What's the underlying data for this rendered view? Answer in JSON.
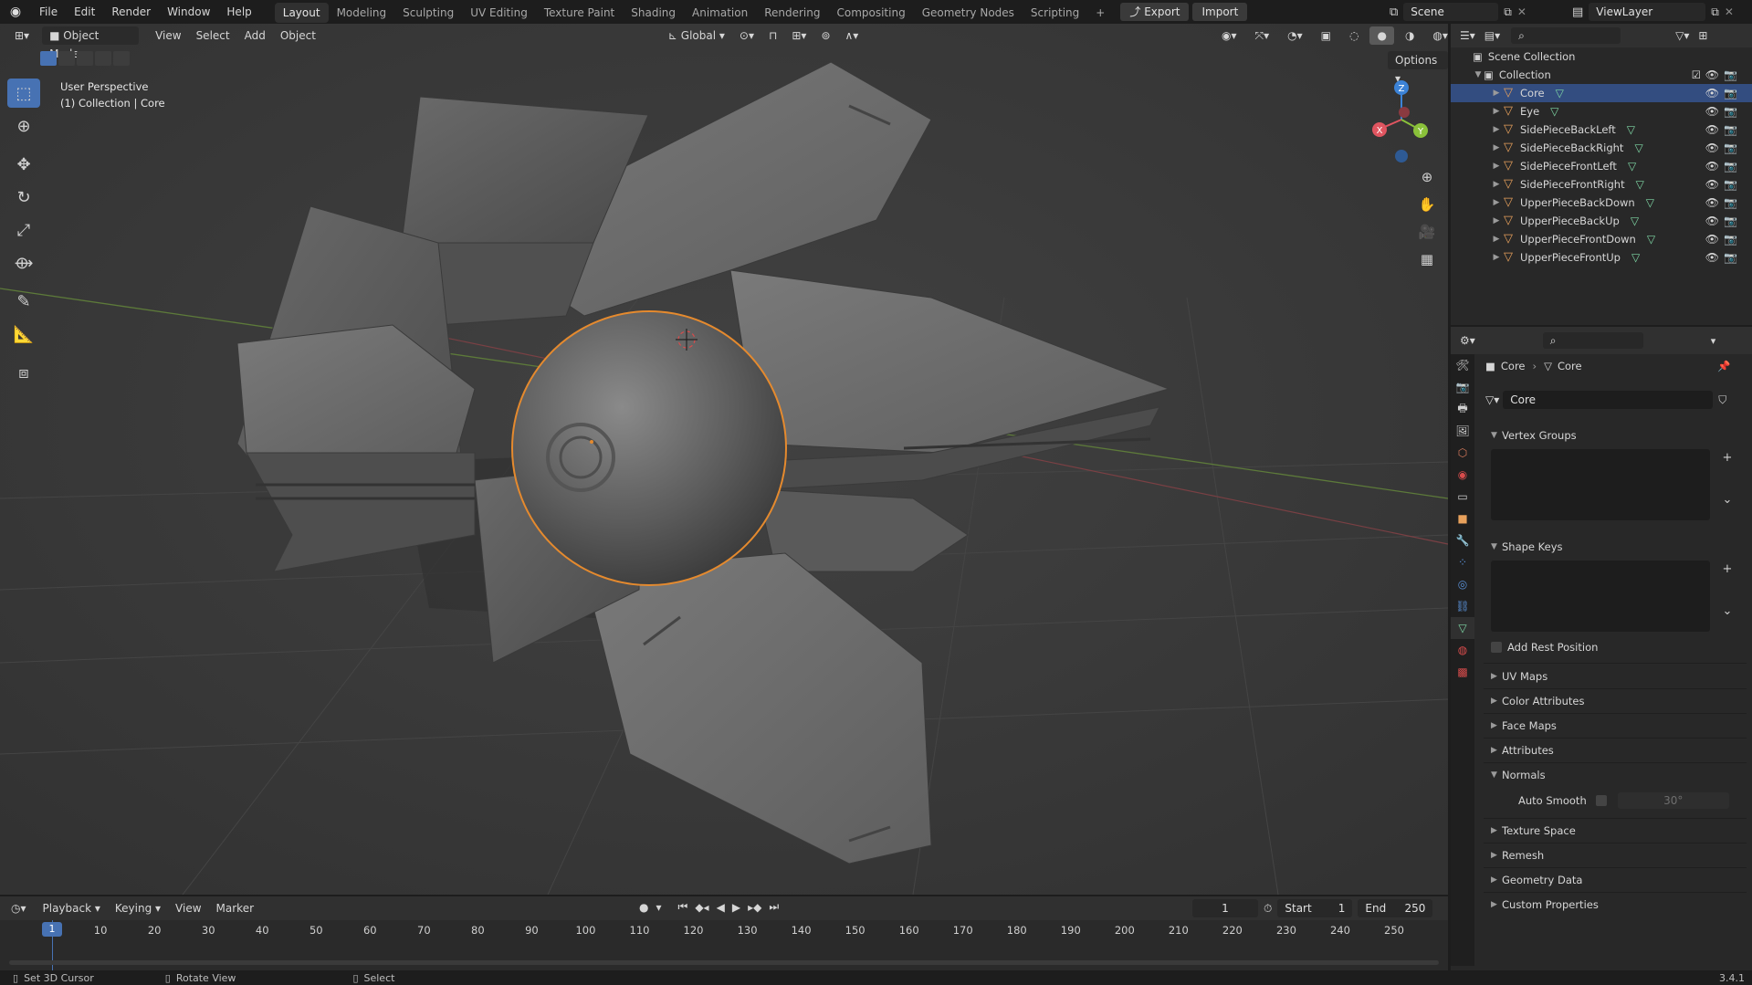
{
  "menus": [
    "File",
    "Edit",
    "Render",
    "Window",
    "Help"
  ],
  "workspaces": [
    "Layout",
    "Modeling",
    "Sculpting",
    "UV Editing",
    "Texture Paint",
    "Shading",
    "Animation",
    "Rendering",
    "Compositing",
    "Geometry Nodes",
    "Scripting"
  ],
  "workspace_add": "+",
  "export_label": "Export",
  "import_label": "Import",
  "scene_name": "Scene",
  "viewlayer_name": "ViewLayer",
  "viewport": {
    "mode": "Object Mode",
    "menus": [
      "View",
      "Select",
      "Add",
      "Object"
    ],
    "orientation": "Global",
    "options_label": "Options",
    "overlay_line1": "User Perspective",
    "overlay_line2": "(1) Collection | Core",
    "gizmo_axes": {
      "z": "Z",
      "x": "X",
      "y": "Y"
    },
    "colors": {
      "x_axis": "#e05560",
      "y_axis": "#8ac13a",
      "z_axis": "#3c83d7",
      "selection": "#e58a2e"
    }
  },
  "outliner": {
    "root": "Scene Collection",
    "collection": "Collection",
    "items": [
      "Core",
      "Eye",
      "SidePieceBackLeft",
      "SidePieceBackRight",
      "SidePieceFrontLeft",
      "SidePieceFrontRight",
      "UpperPieceBackDown",
      "UpperPieceBackUp",
      "UpperPieceFrontDown",
      "UpperPieceFrontUp"
    ],
    "selected": "Core"
  },
  "properties": {
    "breadcrumb_object": "Core",
    "breadcrumb_data": "Core",
    "mesh_name": "Core",
    "panels": {
      "vertex_groups": "Vertex Groups",
      "shape_keys": "Shape Keys",
      "add_rest_position": "Add Rest Position",
      "uv_maps": "UV Maps",
      "color_attributes": "Color Attributes",
      "face_maps": "Face Maps",
      "attributes": "Attributes",
      "normals": "Normals",
      "auto_smooth": "Auto Smooth",
      "auto_smooth_angle": "30°",
      "texture_space": "Texture Space",
      "remesh": "Remesh",
      "geometry_data": "Geometry Data",
      "custom_properties": "Custom Properties"
    }
  },
  "timeline": {
    "menus": [
      "Playback",
      "Keying",
      "View",
      "Marker"
    ],
    "current_frame": "1",
    "start_label": "Start",
    "start": "1",
    "end_label": "End",
    "end": "250",
    "ticks": [
      "1",
      "10",
      "20",
      "30",
      "40",
      "50",
      "60",
      "70",
      "80",
      "90",
      "100",
      "110",
      "120",
      "130",
      "140",
      "150",
      "160",
      "170",
      "180",
      "190",
      "200",
      "210",
      "220",
      "230",
      "240",
      "250"
    ]
  },
  "status": {
    "left": "Set 3D Cursor",
    "middle": "Rotate View",
    "right": "Select",
    "version": "3.4.1"
  }
}
